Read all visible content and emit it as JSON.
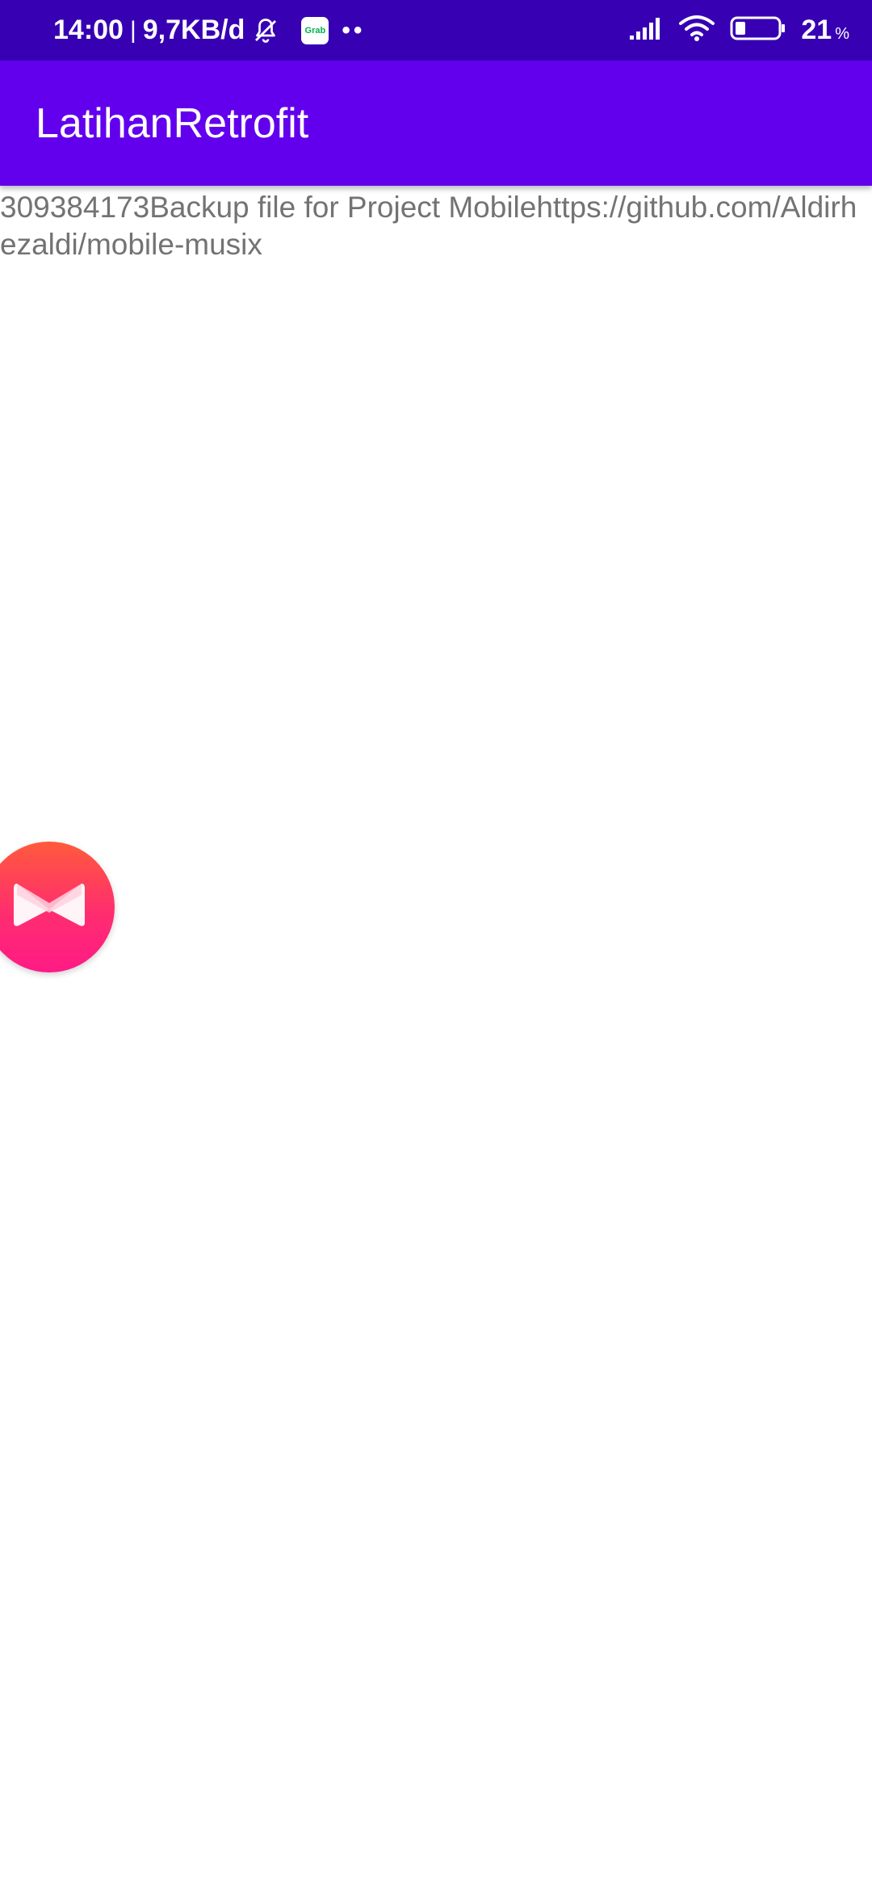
{
  "status_bar": {
    "time": "14:00",
    "separator": "|",
    "data_speed": "9,7KB/d",
    "grab_label": "Grab",
    "more_dots": "••",
    "battery_level": "21",
    "battery_unit": "%",
    "icons": [
      "mute-notifications-icon",
      "grab-app-icon",
      "signal-icon",
      "wifi-icon",
      "battery-icon"
    ]
  },
  "app_bar": {
    "title": "LatihanRetrofit",
    "background_color": "#6200ee",
    "status_color": "#3700b3"
  },
  "content": {
    "text": "309384173Backup file for Project Mobilehttps://github.com/Aldirhezaldi/mobile-musix"
  },
  "floating_bubble": {
    "icon": "musixmatch-icon",
    "color_top": "#ff5a3c",
    "color_bottom": "#ff1a86"
  }
}
